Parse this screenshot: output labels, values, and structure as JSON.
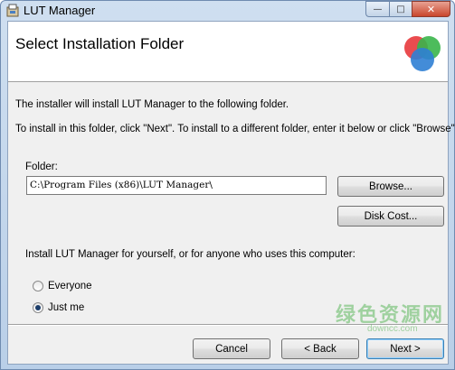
{
  "window": {
    "title": "LUT Manager",
    "minimize_glyph": "—",
    "maximize_glyph": "□",
    "close_glyph": "✕"
  },
  "banner": {
    "title": "Select Installation Folder",
    "logo_icon": "installer-circles-icon",
    "logo_colors": [
      "#e8393c",
      "#3ab54a",
      "#2f7fd4"
    ]
  },
  "body": {
    "line1": "The installer will install LUT Manager to the following folder.",
    "line2": "To install in this folder, click \"Next\". To install to a different folder, enter it below or click \"Browse\"."
  },
  "folder": {
    "label": "Folder:",
    "value": "C:\\Program Files (x86)\\LUT Manager\\",
    "browse_label": "Browse...",
    "diskcost_label": "Disk Cost..."
  },
  "scope": {
    "prompt": "Install LUT Manager for yourself, or for anyone who uses this computer:",
    "options": [
      {
        "label": "Everyone",
        "checked": false
      },
      {
        "label": "Just me",
        "checked": true
      }
    ]
  },
  "footer": {
    "cancel_label": "Cancel",
    "back_label": "< Back",
    "next_label": "Next >"
  },
  "watermark": {
    "text": "绿色资源网",
    "subtext": "downcc.com"
  }
}
